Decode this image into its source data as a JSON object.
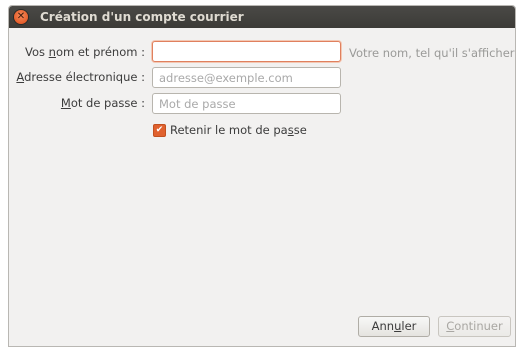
{
  "window": {
    "title": "Création d'un compte courrier"
  },
  "form": {
    "name_label_pre": "Vos ",
    "name_label_ul": "n",
    "name_label_post": "om et prénom :",
    "name_value": "",
    "name_placeholder": "",
    "name_hint": "Votre nom, tel qu'il s'affichera",
    "email_label_ul": "A",
    "email_label_post": "dresse électronique :",
    "email_placeholder": "adresse@exemple.com",
    "password_label_ul": "M",
    "password_label_post": "ot de passe :",
    "password_placeholder": "Mot de passe",
    "remember_label_pre": "Retenir le mot de pa",
    "remember_label_ul": "s",
    "remember_label_post": "se",
    "remember_checked": true
  },
  "buttons": {
    "cancel_pre": "Ann",
    "cancel_ul": "u",
    "cancel_post": "ler",
    "continue_ul": "C",
    "continue_post": "ontinuer"
  },
  "colors": {
    "accent": "#e0612e",
    "titlebar": "#3c3b37"
  },
  "icons": {
    "close": "close-icon",
    "check": "check-icon"
  }
}
